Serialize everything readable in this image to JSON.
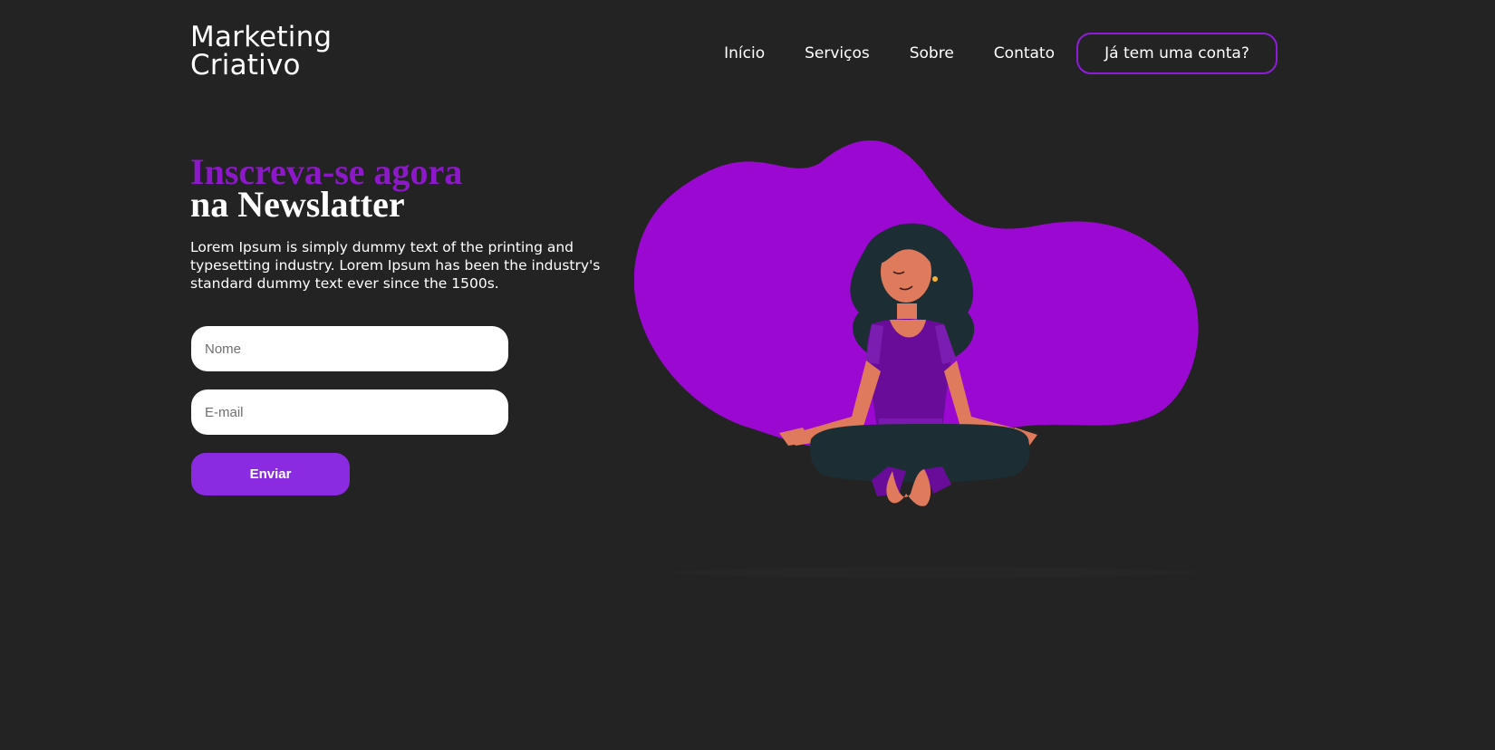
{
  "brand": {
    "line1": "Marketing",
    "line2": "Criativo"
  },
  "nav": {
    "items": [
      {
        "label": "Início"
      },
      {
        "label": "Serviços"
      },
      {
        "label": "Sobre"
      },
      {
        "label": "Contato"
      }
    ],
    "account_button": "Já tem uma conta?"
  },
  "hero": {
    "headline_accent": "Inscreva-se agora",
    "headline_rest": "na Newslatter",
    "description": "Lorem Ipsum is simply dummy text of the printing and typesetting industry. Lorem Ipsum has been the industry's standard dummy text ever since the 1500s."
  },
  "form": {
    "name_placeholder": "Nome",
    "email_placeholder": "E-mail",
    "submit_label": "Enviar"
  },
  "colors": {
    "background": "#232323",
    "accent": "#8d18c9",
    "button": "#8a2be2",
    "blob": "#9b08d2"
  }
}
